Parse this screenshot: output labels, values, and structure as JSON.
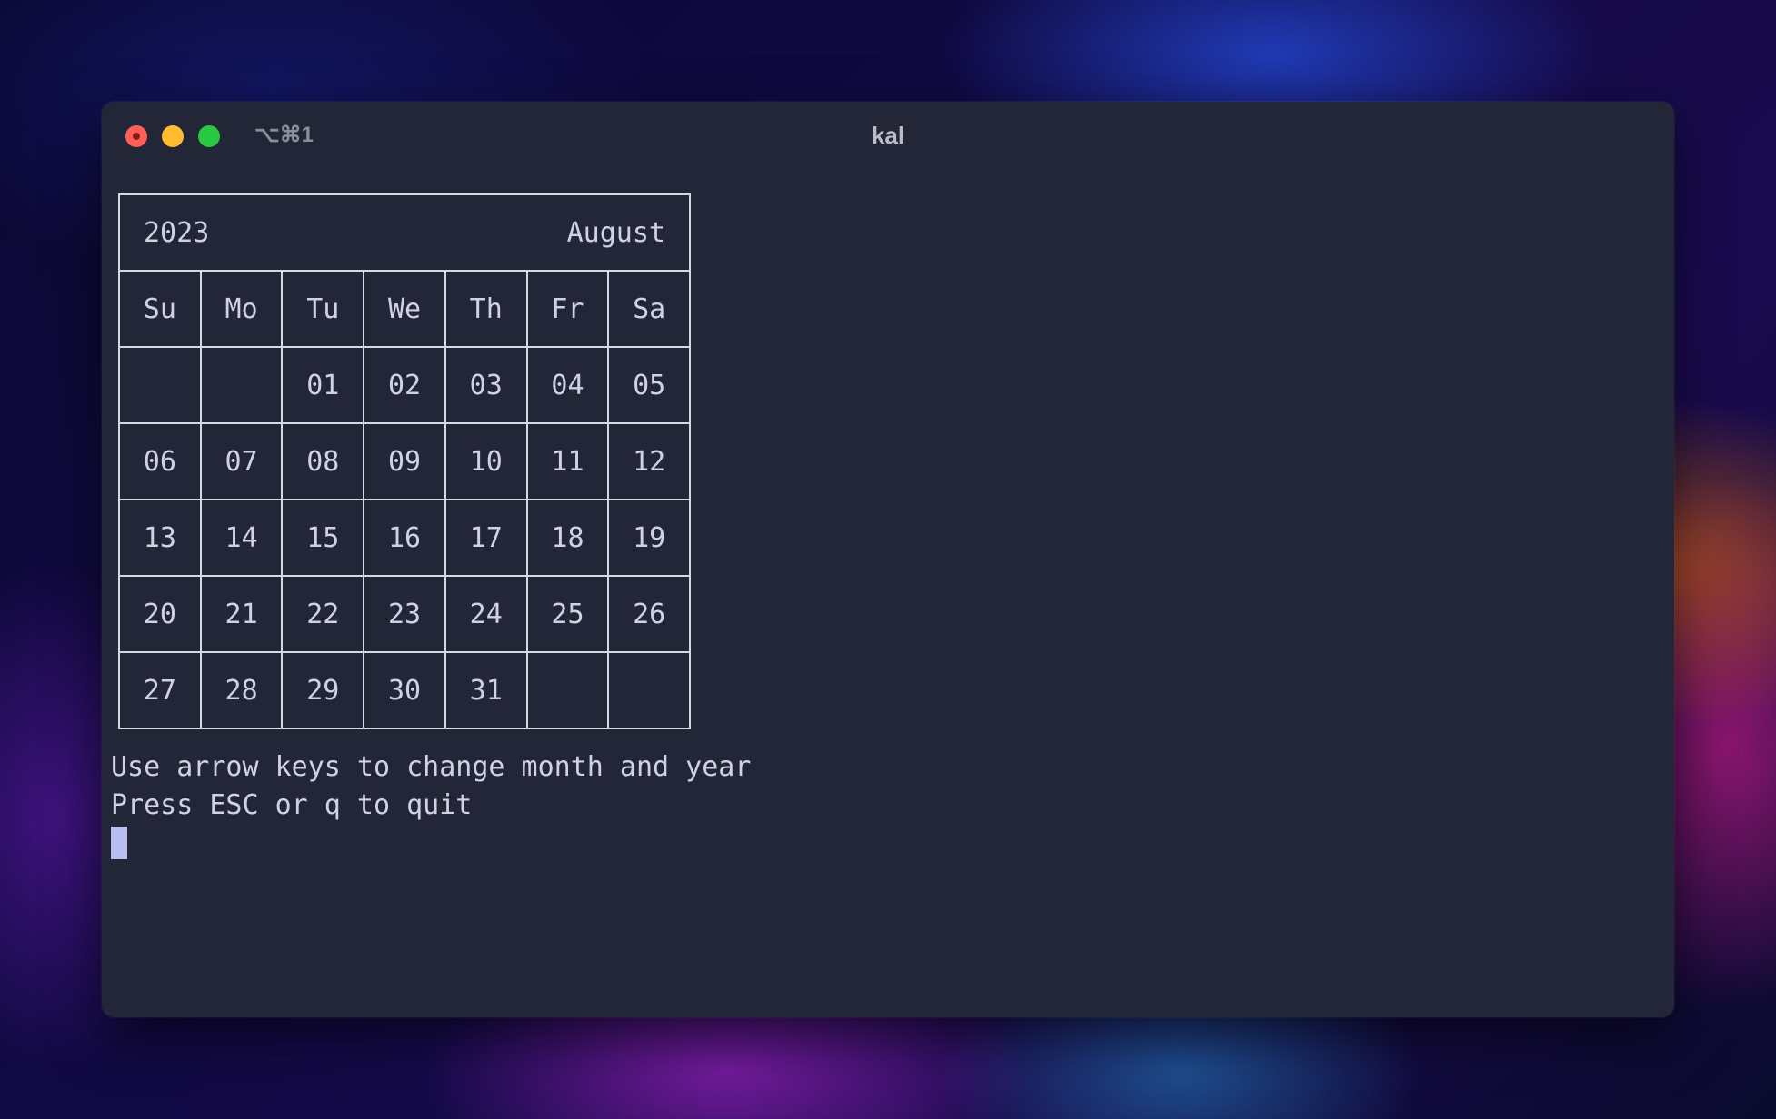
{
  "window": {
    "title": "kal",
    "shortcut": "⌥⌘1"
  },
  "calendar": {
    "year": "2023",
    "month": "August",
    "weekdays": [
      "Su",
      "Mo",
      "Tu",
      "We",
      "Th",
      "Fr",
      "Sa"
    ],
    "weeks": [
      [
        "",
        "",
        "01",
        "02",
        "03",
        "04",
        "05"
      ],
      [
        "06",
        "07",
        "08",
        "09",
        "10",
        "11",
        "12"
      ],
      [
        "13",
        "14",
        "15",
        "16",
        "17",
        "18",
        "19"
      ],
      [
        "20",
        "21",
        "22",
        "23",
        "24",
        "25",
        "26"
      ],
      [
        "27",
        "28",
        "29",
        "30",
        "31",
        "",
        ""
      ]
    ]
  },
  "help": {
    "line1": "Use arrow keys to change month and year",
    "line2": "Press ESC or q to quit"
  }
}
